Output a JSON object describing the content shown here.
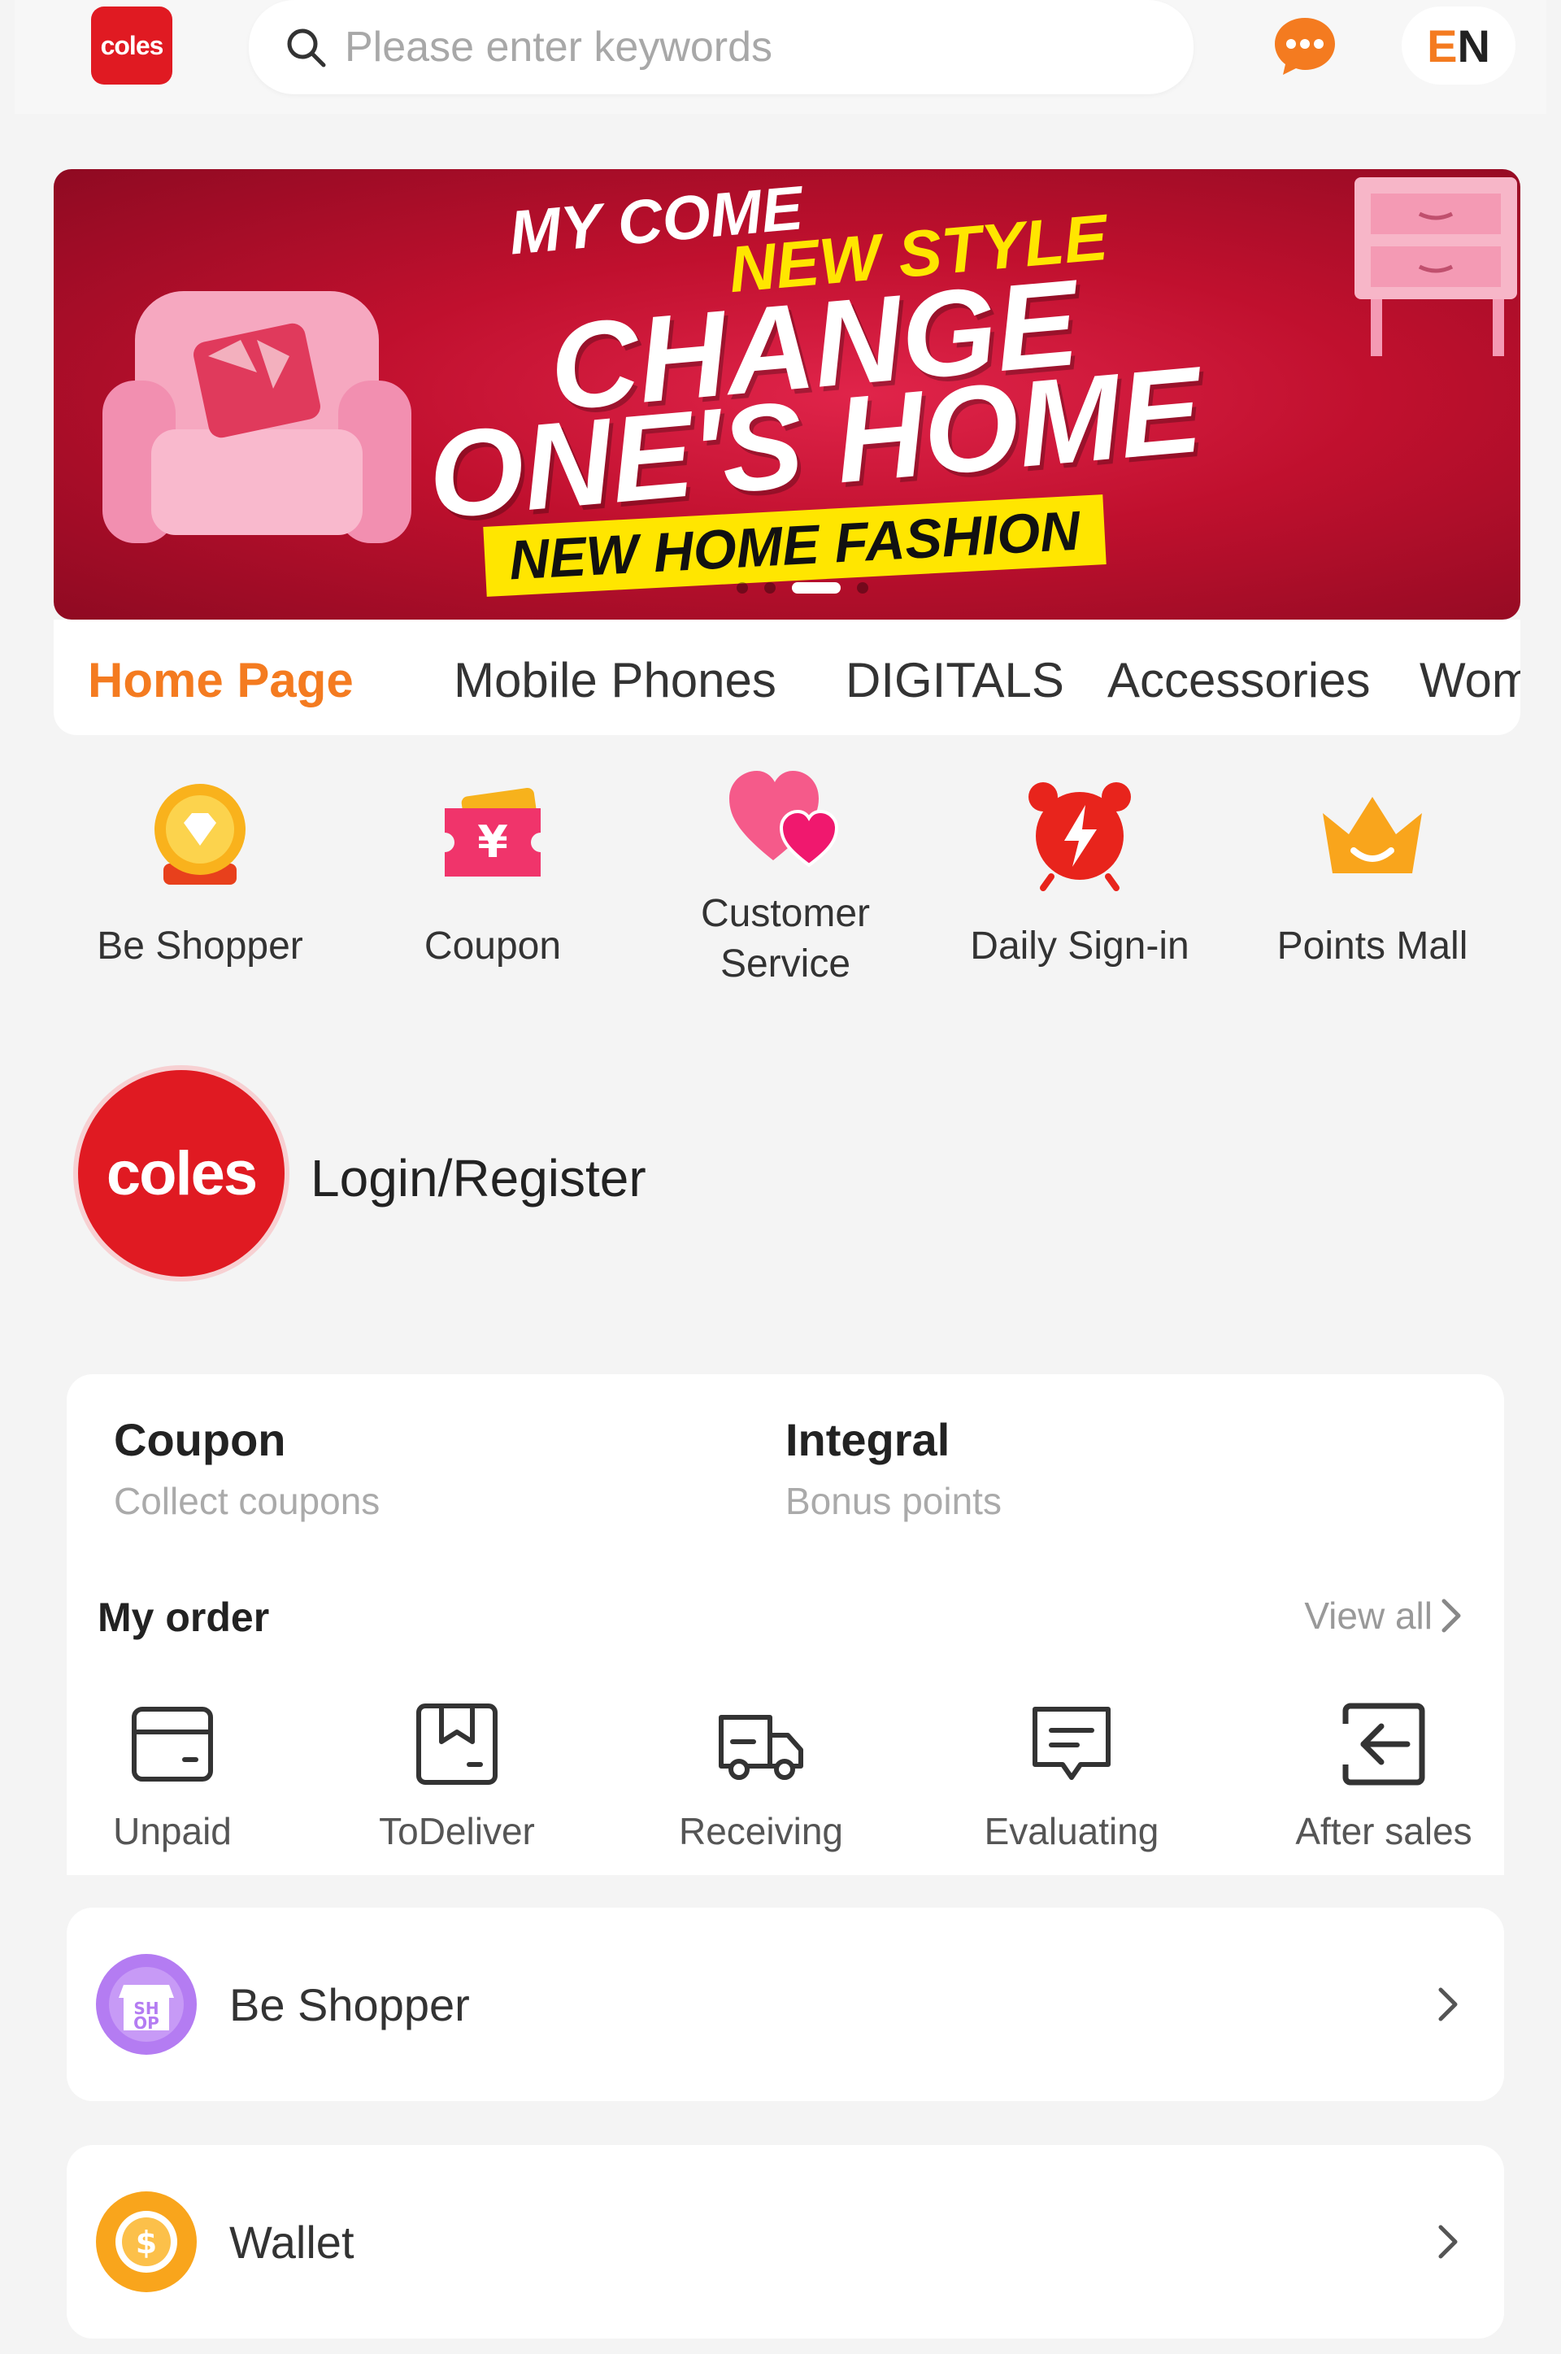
{
  "header": {
    "logo_text": "coles",
    "search_placeholder": "Please enter keywords",
    "lang_e": "E",
    "lang_n": "N",
    "accent": "#f47b20",
    "brand": "#e01a22"
  },
  "banner": {
    "line1": "MY COME",
    "line2": "NEW STYLE",
    "line3": "CHANGE",
    "line4": "ONE'S HOME",
    "line5": "NEW HOME FASHION",
    "slides": 4,
    "active_slide": 3
  },
  "tabs": [
    "Home Page",
    "Mobile Phones",
    "DIGITALS",
    "Accessories",
    "Wom"
  ],
  "quick": [
    {
      "label": "Be Shopper",
      "icon": "diamond-medal-icon"
    },
    {
      "label": "Coupon",
      "icon": "yen-ticket-icon"
    },
    {
      "label": "Customer Service",
      "icon": "hearts-icon"
    },
    {
      "label": "Daily Sign-in",
      "icon": "alarm-clock-icon"
    },
    {
      "label": "Points Mall",
      "icon": "crown-icon"
    }
  ],
  "user": {
    "avatar_text": "coles",
    "login_label": "Login/Register"
  },
  "stats": {
    "coupon_title": "Coupon",
    "coupon_sub": "Collect coupons",
    "integral_title": "Integral",
    "integral_sub": "Bonus points"
  },
  "orders": {
    "title": "My order",
    "view_all": "View all",
    "items": [
      {
        "label": "Unpaid",
        "icon": "wallet-outline-icon"
      },
      {
        "label": "ToDeliver",
        "icon": "bookmark-box-icon"
      },
      {
        "label": "Receiving",
        "icon": "truck-icon"
      },
      {
        "label": "Evaluating",
        "icon": "comment-icon"
      },
      {
        "label": "After sales",
        "icon": "return-arrow-icon"
      }
    ]
  },
  "menu": [
    {
      "label": "Be Shopper",
      "icon": "shop-icon",
      "icon_text": "SH OP"
    },
    {
      "label": "Wallet",
      "icon": "coin-icon",
      "icon_text": "$"
    }
  ]
}
